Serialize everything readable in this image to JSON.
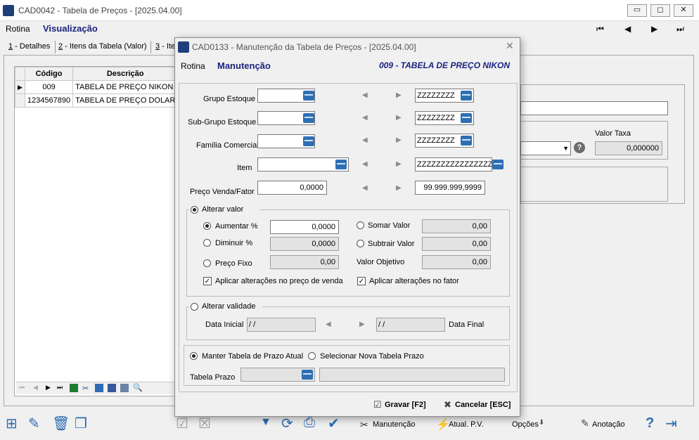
{
  "main_window": {
    "title": "CAD0042 - Tabela de Preços - [2025.04.00]",
    "minimize": "▭",
    "restore": "◻",
    "close": "✕",
    "menu": {
      "rotina": "Rotina",
      "visualizacao": "Visualização"
    },
    "nav": {
      "first": "⏮",
      "prev": "◀",
      "next": "▶",
      "last": "⏭"
    },
    "tabs": [
      {
        "key": "1",
        "label": " - Detalhes"
      },
      {
        "key": "2",
        "label": " - Itens da Tabela (Valor)"
      },
      {
        "key": "3",
        "label": " - Ite"
      }
    ],
    "grid": {
      "headers": [
        "Código",
        "Descrição"
      ],
      "rows": [
        {
          "codigo": "009",
          "descricao": "TABELA DE PREÇO NIKON"
        },
        {
          "codigo": "1234567890",
          "descricao": "TABELA DE PREÇO DOLAR"
        }
      ]
    },
    "right_panel": {
      "valor_taxa_label": "Valor Taxa",
      "valor_taxa_value": "0,000000",
      "help_icon": "?"
    },
    "toolbar": {
      "manutencao": "Manutenção",
      "atual_pv": "Atual. P.V.",
      "opcoes": "Opções",
      "anotacao": "Anotação"
    }
  },
  "dialog": {
    "title": "CAD0133 - Manutenção da Tabela de Preços - [2025.04.00]",
    "close": "✕",
    "menu": {
      "rotina": "Rotina",
      "manutencao": "Manutenção",
      "header_title": "009 - TABELA DE PREÇO NIKON"
    },
    "ranges": {
      "grupo_estoque": {
        "label": "Grupo Estoque",
        "from": "",
        "to": "ZZZZZZZZ"
      },
      "sub_grupo_estoque": {
        "label": "Sub-Grupo Estoque",
        "from": "",
        "to": "ZZZZZZZZ"
      },
      "familia_comercial": {
        "label": "Família Comercial",
        "from": "",
        "to": "ZZZZZZZZ"
      },
      "item": {
        "label": "Item",
        "from": "",
        "to": "ZZZZZZZZZZZZZZZZZZZZ"
      },
      "preco_venda_fator": {
        "label": "Preço Venda/Fator",
        "from": "0,0000",
        "to": "99.999.999,9999"
      }
    },
    "alterar_valor": {
      "label": "Alterar valor",
      "aumentar": {
        "label": "Aumentar %",
        "value": "0,0000"
      },
      "diminuir": {
        "label": "Diminuir %",
        "value": "0,0000"
      },
      "preco_fixo": {
        "label": "Preço Fixo",
        "value": "0,00"
      },
      "somar": {
        "label": "Somar Valor",
        "value": "0,00"
      },
      "subtrair": {
        "label": "Subtrair Valor",
        "value": "0,00"
      },
      "valor_objetivo": {
        "label": "Valor Objetivo",
        "value": "0,00"
      },
      "aplicar_preco_venda": "Aplicar alterações no preço de venda",
      "aplicar_fator": "Aplicar alterações no fator"
    },
    "alterar_validade": {
      "label": "Alterar validade",
      "data_inicial_label": "Data Inicial",
      "data_inicial": " / /",
      "data_final_label": "Data Final",
      "data_final": " / /"
    },
    "prazo": {
      "manter": "Manter Tabela de Prazo Atual",
      "selecionar": "Selecionar Nova Tabela Prazo",
      "tabela_prazo_label": "Tabela Prazo"
    },
    "buttons": {
      "gravar": "Gravar [F2]",
      "cancelar": "Cancelar [ESC]"
    }
  }
}
